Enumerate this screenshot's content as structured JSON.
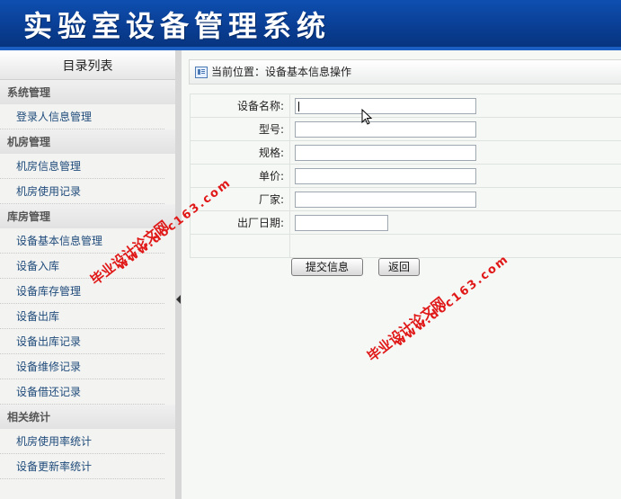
{
  "header": {
    "title": "实验室设备管理系统"
  },
  "sidebar": {
    "title": "目录列表",
    "groups": [
      {
        "label": "系统管理",
        "items": [
          "登录人信息管理"
        ]
      },
      {
        "label": "机房管理",
        "items": [
          "机房信息管理",
          "机房使用记录"
        ]
      },
      {
        "label": "库房管理",
        "items": [
          "设备基本信息管理",
          "设备入库",
          "设备库存管理",
          "设备出库",
          "设备出库记录",
          "设备维修记录",
          "设备借还记录"
        ]
      },
      {
        "label": "相关统计",
        "items": [
          "机房使用率统计",
          "设备更新率统计"
        ]
      }
    ]
  },
  "breadcrumb": {
    "text": "当前位置：设备基本信息操作"
  },
  "form": {
    "fields": [
      {
        "label": "设备名称:",
        "value": ""
      },
      {
        "label": "型号:",
        "value": ""
      },
      {
        "label": "规格:",
        "value": ""
      },
      {
        "label": "单价:",
        "value": ""
      },
      {
        "label": "厂家:",
        "value": ""
      },
      {
        "label": "出厂日期:",
        "value": ""
      }
    ],
    "submit_label": "提交信息",
    "back_label": "返回"
  },
  "watermarks": {
    "text_cn": "毕业设计论文网",
    "text_url": "www.doc163.com"
  },
  "colors": {
    "header_bg": "#0a3f95",
    "watermark": "#e01818",
    "link": "#1f4a7a"
  }
}
